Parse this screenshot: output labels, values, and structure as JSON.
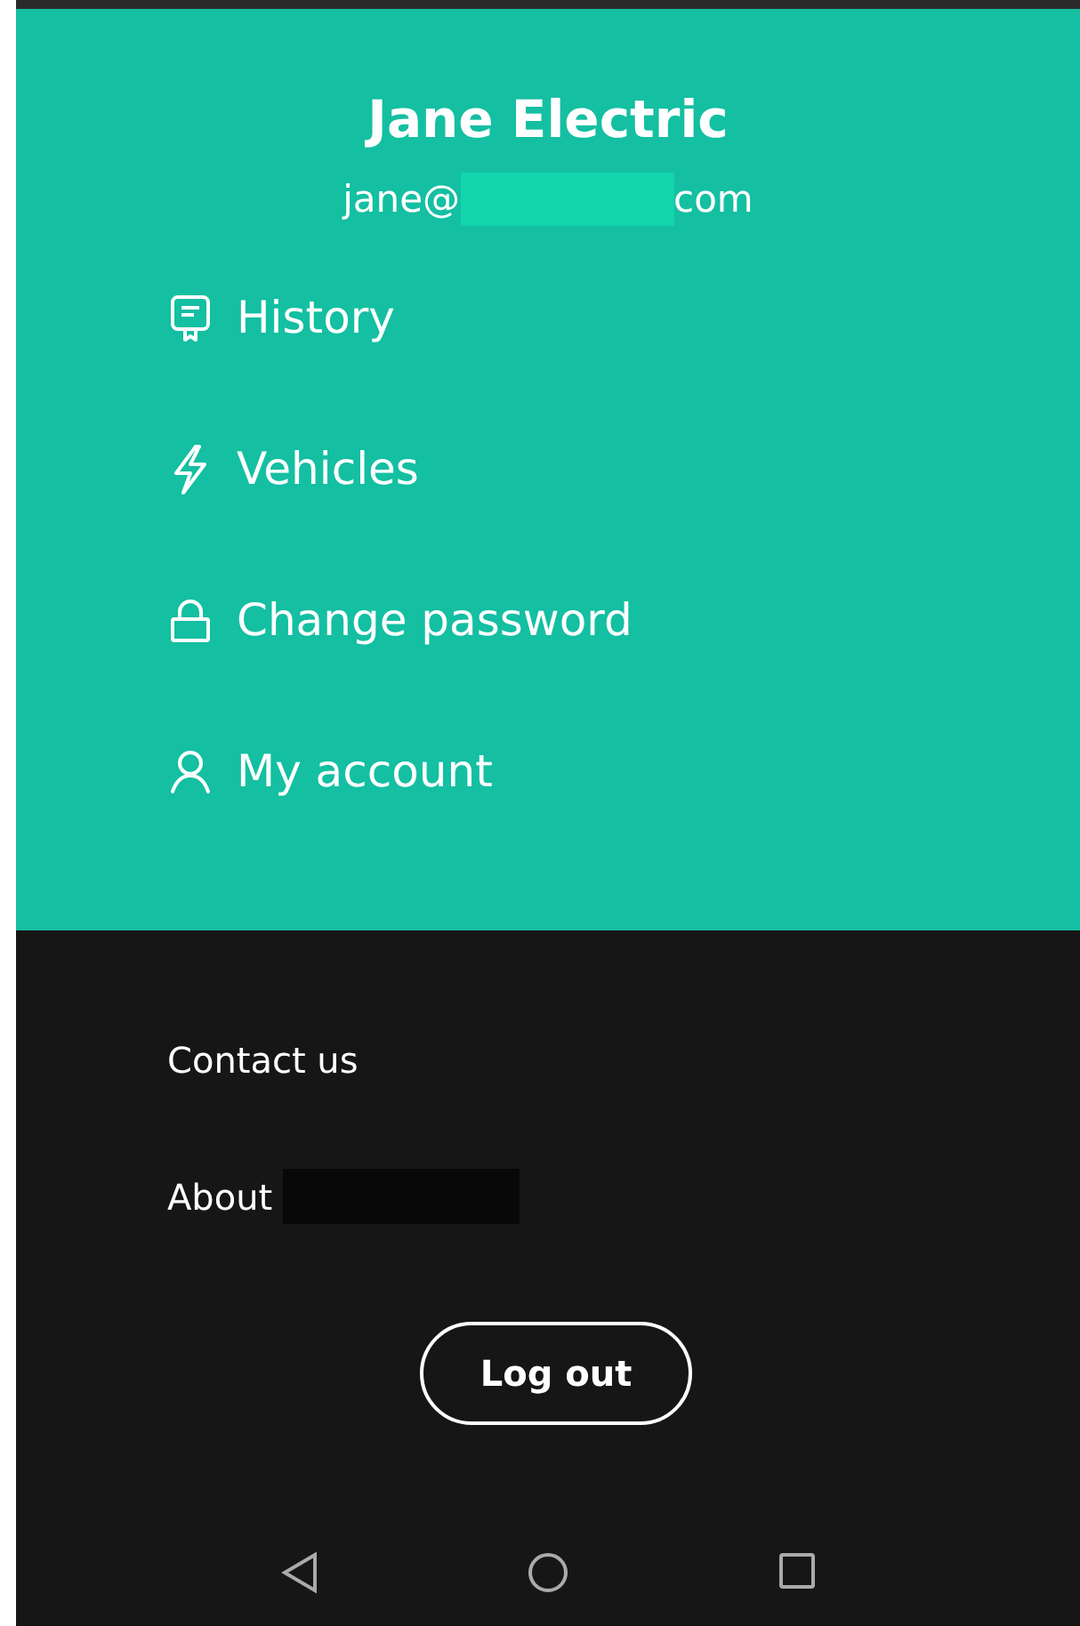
{
  "profile": {
    "name": "Jane Electric",
    "email_start": "jane@",
    "email_end": "com",
    "email_redacted": true
  },
  "menu": [
    {
      "label": "History"
    },
    {
      "label": "Vehicles"
    },
    {
      "label": "Change password"
    },
    {
      "label": "My account"
    }
  ],
  "links": [
    {
      "label": "Contact us",
      "redacted": false
    },
    {
      "label": "About",
      "redacted": true
    }
  ],
  "logout_button": "Log out"
}
